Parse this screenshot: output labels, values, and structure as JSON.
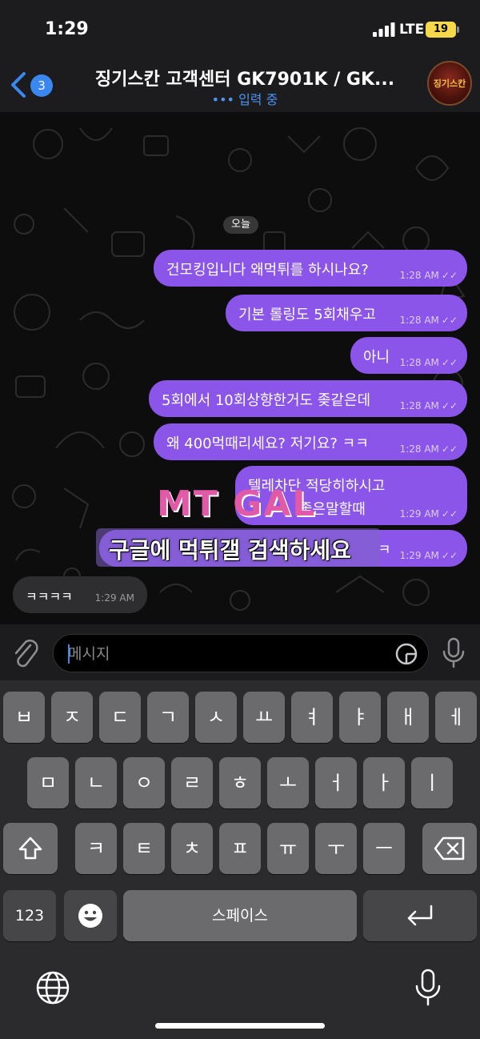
{
  "status_bar": {
    "time": "1:29",
    "network": "LTE",
    "battery": "19"
  },
  "header": {
    "back_badge": "3",
    "title": "징기스칸 고객센터 GK7901K / GK...",
    "typing_status": "••• 입력 중",
    "avatar_label": "징기스칸"
  },
  "chat": {
    "date_label": "오늘",
    "outgoing_messages": [
      {
        "text": "건모킹입니다 왜먹튀를 하시나요?",
        "time": "1:28 AM"
      },
      {
        "text": "기본 롤링도 5회채우고",
        "time": "1:28 AM"
      },
      {
        "text": "아니",
        "time": "1:28 AM"
      },
      {
        "text": "5회에서 10회상향한거도 좆같은데",
        "time": "1:28 AM"
      },
      {
        "text": "왜 400먹때리세요? 저기요? ㅋㅋ",
        "time": "1:28 AM"
      },
      {
        "text": "텔레차단 적당히하시고",
        "text2": "좋은말할때",
        "time": "1:29 AM"
      },
      {
        "text": "ㅋ",
        "time": "1:29 AM"
      }
    ],
    "incoming_messages": [
      {
        "text": "ㅋㅋㅋㅋ",
        "time": "1:29 AM"
      }
    ],
    "watermark_logo": "MT GAL",
    "watermark_banner": "구글에 먹튀갤 검색하세요"
  },
  "input_bar": {
    "placeholder": "메시지"
  },
  "keyboard": {
    "row1": [
      "ㅂ",
      "ㅈ",
      "ㄷ",
      "ㄱ",
      "ㅅ",
      "ㅛ",
      "ㅕ",
      "ㅑ",
      "ㅐ",
      "ㅔ"
    ],
    "row2": [
      "ㅁ",
      "ㄴ",
      "ㅇ",
      "ㄹ",
      "ㅎ",
      "ㅗ",
      "ㅓ",
      "ㅏ",
      "ㅣ"
    ],
    "row3": [
      "ㅋ",
      "ㅌ",
      "ㅊ",
      "ㅍ",
      "ㅠ",
      "ㅜ",
      "ㅡ"
    ],
    "numbers_key": "123",
    "space_key": "스페이스"
  },
  "colors": {
    "outgoing_bubble": "#8a55e8",
    "accent_blue": "#3a87f0",
    "incoming_bubble": "#2e2e30"
  }
}
